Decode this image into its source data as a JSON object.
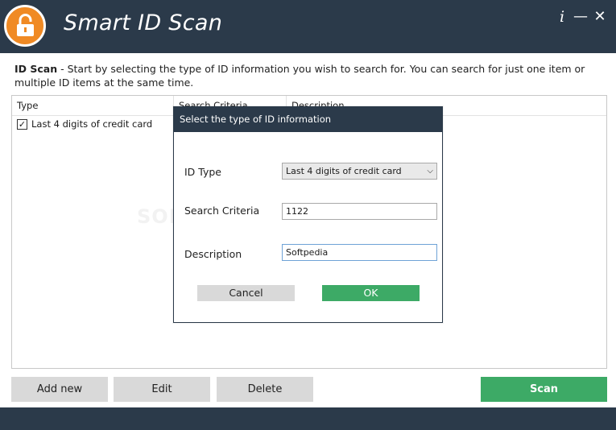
{
  "app": {
    "title": "Smart ID Scan",
    "info_label": "i",
    "minimize_label": "—",
    "close_label": "✕"
  },
  "intro": {
    "heading": "ID Scan",
    "text": " - Start by selecting the type of ID information you wish to search for.  You can search for just one item or multiple ID items at the same time."
  },
  "grid": {
    "columns": [
      "Type",
      "Search Criteria",
      "Description"
    ],
    "rows": [
      {
        "checked": true,
        "type": "Last 4 digits of credit card"
      }
    ]
  },
  "watermark": "SOFTPEDIA",
  "buttons": {
    "add_new": "Add new",
    "edit": "Edit",
    "delete": "Delete",
    "scan": "Scan"
  },
  "dialog": {
    "title": "Select the type of ID information",
    "id_type_label": "ID Type",
    "id_type_value": "Last 4 digits of credit card",
    "search_criteria_label": "Search Criteria",
    "search_criteria_value": "1122",
    "description_label": "Description",
    "description_value": "Softpedia",
    "cancel_label": "Cancel",
    "ok_label": "OK"
  },
  "colors": {
    "titlebar": "#2b3a4a",
    "accent_green": "#3daa66",
    "logo_orange": "#f08a24",
    "button_gray": "#d9d9d9"
  }
}
